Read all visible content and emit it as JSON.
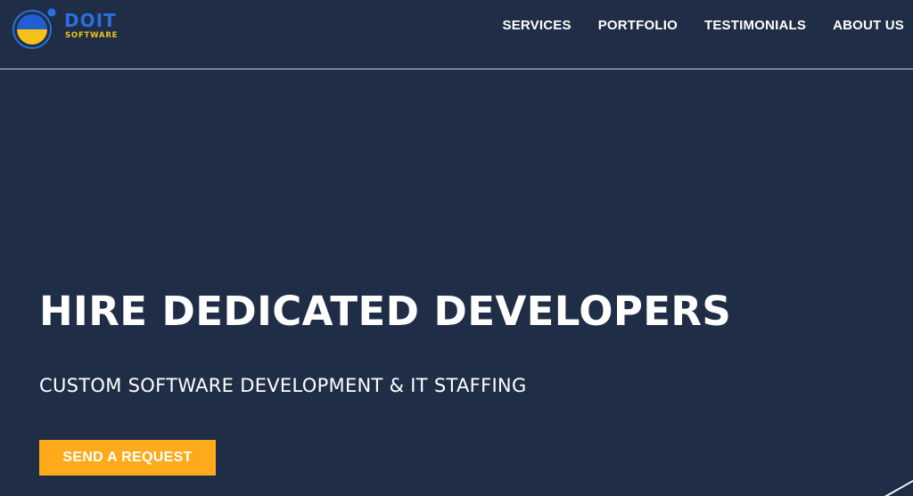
{
  "header": {
    "logo": {
      "word": "DOIT",
      "sub": "SOFTWARE"
    },
    "nav": [
      {
        "label": "SERVICES"
      },
      {
        "label": "PORTFOLIO"
      },
      {
        "label": "TESTIMONIALS"
      },
      {
        "label": "ABOUT US"
      }
    ]
  },
  "hero": {
    "title": "HIRE DEDICATED DEVELOPERS",
    "subtitle": "CUSTOM SOFTWARE DEVELOPMENT & IT STAFFING",
    "cta_label": "SEND A REQUEST"
  },
  "colors": {
    "background": "#1f2e46",
    "accent": "#fdab1b",
    "logo_blue": "#2a6fe0",
    "logo_yellow": "#f4c21a"
  },
  "icons": {
    "logo_mark": "ukraine-flag-globe-icon"
  }
}
